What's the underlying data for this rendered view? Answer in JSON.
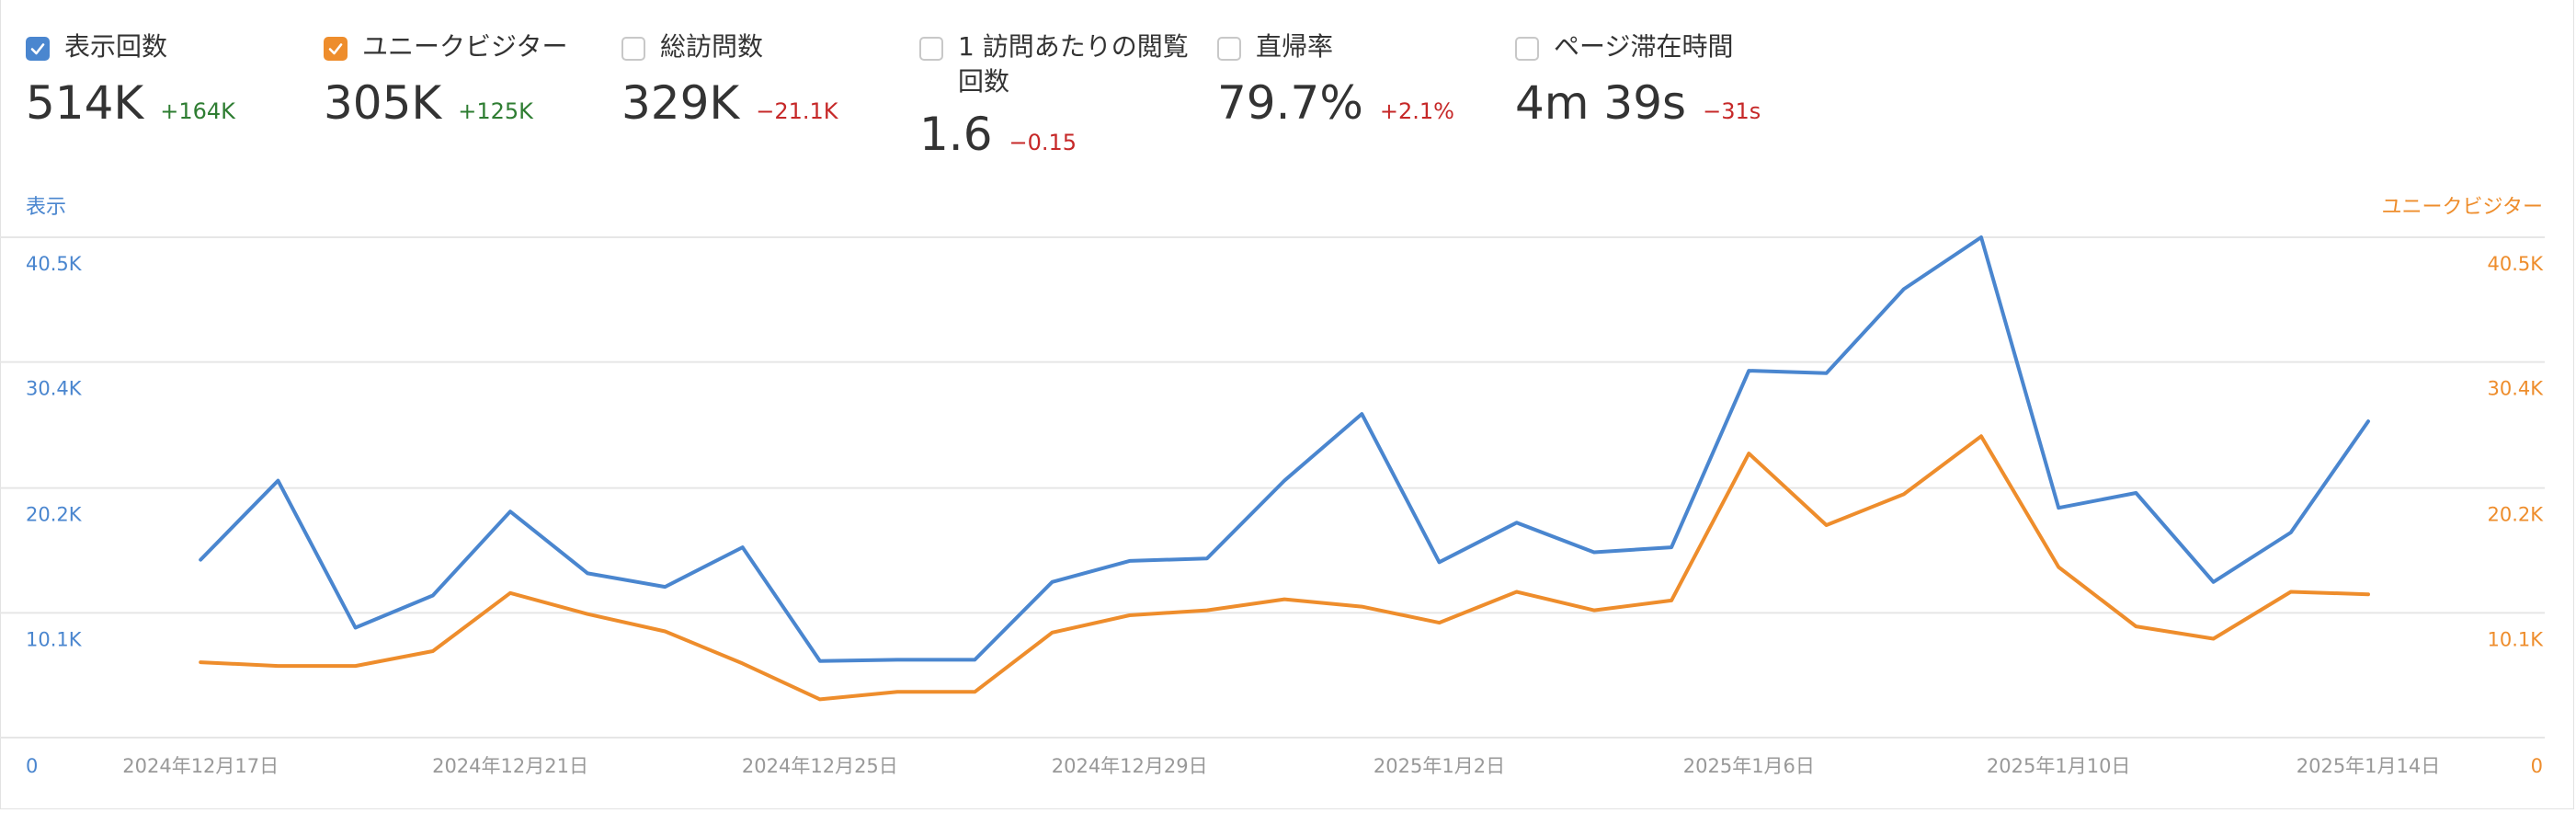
{
  "metrics": [
    {
      "label": "表示回数",
      "value": "514K",
      "delta": "+164K",
      "trend": "pos",
      "checked": true,
      "color": "#4a86cf"
    },
    {
      "label": "ユニークビジター",
      "value": "305K",
      "delta": "+125K",
      "trend": "pos",
      "checked": true,
      "color": "#ee8d2c"
    },
    {
      "label": "総訪問数",
      "value": "329K",
      "delta": "−21.1K",
      "trend": "neg",
      "checked": false,
      "color": ""
    },
    {
      "label": "1 訪問あたりの閲覧",
      "label2": "回数",
      "value": "1.6",
      "delta": "−0.15",
      "trend": "neg",
      "checked": false,
      "color": ""
    },
    {
      "label": "直帰率",
      "value": "79.7%",
      "delta": "+2.1%",
      "trend": "pos",
      "checked": false,
      "color": ""
    },
    {
      "label": "ページ滞在時間",
      "value": "4m 39s",
      "delta": "−31s",
      "trend": "neg",
      "checked": false,
      "color": ""
    }
  ],
  "colors": {
    "impressions": "#4a86cf",
    "visitors": "#ee8d2c",
    "grid": "#e6e6e6"
  },
  "chart_data": {
    "type": "line",
    "left_axis_title": "表示",
    "right_axis_title": "ユニークビジター",
    "y_ticks": [
      0,
      10100,
      20200,
      30400,
      40500
    ],
    "y_tick_labels": [
      "0",
      "10.1K",
      "20.2K",
      "30.4K",
      "40.5K"
    ],
    "ylim": [
      0,
      40500
    ],
    "x_start": "2024-12-16",
    "x_end": "2025-01-14",
    "x_ticks": [
      {
        "date": "2024-12-17",
        "label": "2024年12月17日"
      },
      {
        "date": "2024-12-21",
        "label": "2024年12月21日"
      },
      {
        "date": "2024-12-25",
        "label": "2024年12月25日"
      },
      {
        "date": "2024-12-29",
        "label": "2024年12月29日"
      },
      {
        "date": "2025-01-02",
        "label": "2025年1月2日"
      },
      {
        "date": "2025-01-06",
        "label": "2025年1月6日"
      },
      {
        "date": "2025-01-10",
        "label": "2025年1月10日"
      },
      {
        "date": "2025-01-14",
        "label": "2025年1月14日"
      }
    ],
    "dates": [
      "2024-12-17",
      "2024-12-18",
      "2024-12-19",
      "2024-12-20",
      "2024-12-21",
      "2024-12-22",
      "2024-12-23",
      "2024-12-24",
      "2024-12-25",
      "2024-12-26",
      "2024-12-27",
      "2024-12-28",
      "2024-12-29",
      "2024-12-30",
      "2024-12-31",
      "2025-01-01",
      "2025-01-02",
      "2025-01-03",
      "2025-01-04",
      "2025-01-05",
      "2025-01-06",
      "2025-01-07",
      "2025-01-08",
      "2025-01-09",
      "2025-01-10",
      "2025-01-11",
      "2025-01-12",
      "2025-01-13",
      "2025-01-14"
    ],
    "series": [
      {
        "name": "表示",
        "color": "#4a86cf",
        "values": [
          14400,
          20800,
          8900,
          11500,
          18300,
          13300,
          12200,
          15400,
          6200,
          6300,
          6300,
          12600,
          14300,
          14500,
          20800,
          26200,
          14200,
          17400,
          15000,
          15400,
          29700,
          29500,
          36300,
          40500,
          18600,
          19800,
          12600,
          16600,
          25600
        ]
      },
      {
        "name": "ユニークビジター",
        "color": "#ee8d2c",
        "values": [
          6100,
          5800,
          5800,
          7000,
          11700,
          10000,
          8600,
          6000,
          3100,
          3700,
          3700,
          8500,
          9900,
          10300,
          11200,
          10600,
          9300,
          11800,
          10300,
          11100,
          23000,
          17200,
          19700,
          24400,
          13800,
          9000,
          8000,
          11800,
          11600
        ]
      }
    ]
  }
}
